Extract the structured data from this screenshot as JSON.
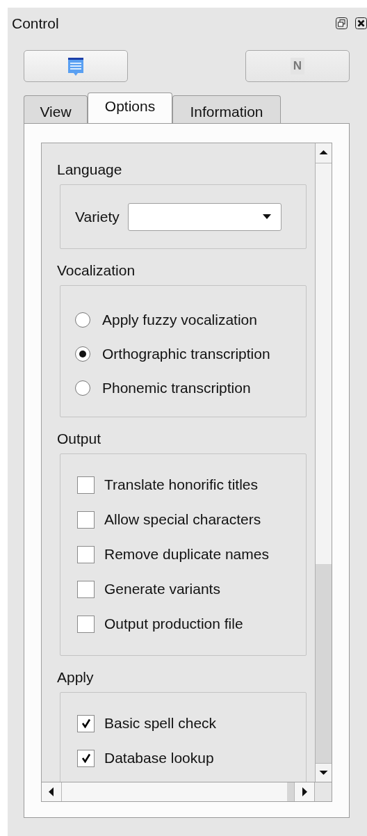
{
  "window": {
    "title": "Control"
  },
  "toolbar": [
    {
      "kind": "icon",
      "disabled": false
    },
    {
      "kind": "text",
      "label": "N",
      "disabled": true
    }
  ],
  "tabs": [
    {
      "label": "View",
      "selected": false
    },
    {
      "label": "Options",
      "selected": true
    },
    {
      "label": "Information",
      "selected": false
    }
  ],
  "sections": [
    {
      "title": "Language",
      "kind": "combo",
      "label": "Variety"
    },
    {
      "title": "Vocalization",
      "kind": "radio",
      "options": [
        {
          "label": "Apply fuzzy vocalization",
          "selected": false
        },
        {
          "label": "Orthographic transcription",
          "selected": true
        },
        {
          "label": "Phonemic transcription",
          "selected": false
        }
      ]
    },
    {
      "title": "Output",
      "kind": "check",
      "options": [
        {
          "label": "Translate honorific titles",
          "checked": false
        },
        {
          "label": "Allow special characters",
          "checked": false
        },
        {
          "label": "Remove duplicate names",
          "checked": false
        },
        {
          "label": "Generate variants",
          "checked": false
        },
        {
          "label": "Output production file",
          "checked": false
        }
      ]
    },
    {
      "title": "Apply",
      "kind": "check",
      "options": [
        {
          "label": "Basic spell check",
          "checked": true
        },
        {
          "label": "Database lookup",
          "checked": true
        }
      ]
    }
  ]
}
